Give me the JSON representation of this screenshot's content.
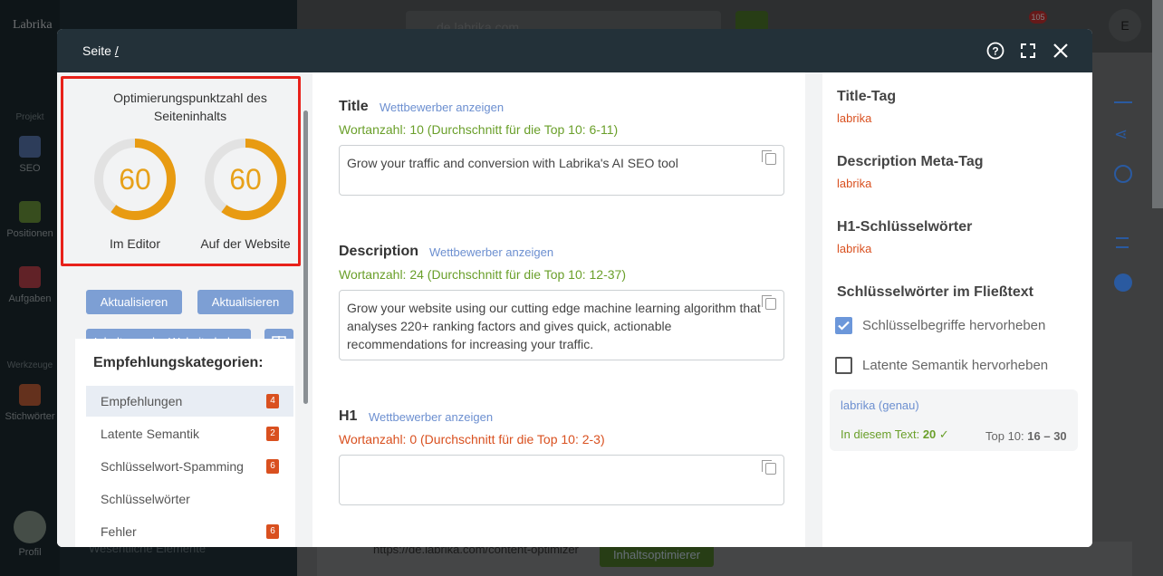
{
  "app": {
    "brand": "Labrika",
    "url_bar": "de.labrika.com",
    "notif_count": "105",
    "avatar_letter": "E"
  },
  "sidebar": {
    "sections": [
      {
        "label": "Projekt"
      },
      {
        "label": "Werkzeuge"
      }
    ],
    "items": [
      {
        "label": "SEO"
      },
      {
        "label": "Positionen"
      },
      {
        "label": "Aufgaben"
      },
      {
        "label": "Stichwörter"
      },
      {
        "label": "Profil"
      }
    ]
  },
  "background": {
    "nav_item": "Wesentliche Elemente",
    "page_url": "https://de.labrika.com/content-optimizer",
    "action_btn": "Inhaltsoptimierer"
  },
  "modal": {
    "title_prefix": "Seite",
    "title_path": "/",
    "scores": {
      "heading": "Optimierungspunktzahl des Seiteninhalts",
      "editor": {
        "value": "60",
        "fraction": 0.6,
        "label": "Im Editor"
      },
      "website": {
        "value": "60",
        "fraction": 0.6,
        "label": "Auf der Website"
      },
      "update_label": "Aktualisieren"
    },
    "load_btn": "Inhalt von der Website laden",
    "categories": {
      "title": "Empfehlungskategorien:",
      "items": [
        {
          "label": "Empfehlungen",
          "count": "4"
        },
        {
          "label": "Latente Semantik",
          "count": "2"
        },
        {
          "label": "Schlüsselwort-Spamming",
          "count": "6"
        },
        {
          "label": "Schlüsselwörter",
          "count": ""
        },
        {
          "label": "Fehler",
          "count": "6"
        }
      ]
    },
    "fields": {
      "competitors_link": "Wettbewerber anzeigen",
      "title": {
        "label": "Title",
        "wordcount": "Wortanzahl: 10 (Durchschnitt für die Top 10: 6-11)",
        "value": "Grow your traffic and conversion with Labrika's AI SEO tool"
      },
      "description": {
        "label": "Description",
        "wordcount": "Wortanzahl: 24 (Durchschnitt für die Top 10: 12-37)",
        "value": "Grow your website using our cutting edge machine learning algorithm that analyses 220+ ranking factors and gives quick, actionable recommendations for increasing your traffic."
      },
      "h1": {
        "label": "H1",
        "wordcount": "Wortanzahl: 0 (Durchschnitt für die Top 10: 2-3)",
        "value": ""
      }
    },
    "right": {
      "title_tag": {
        "label": "Title-Tag",
        "value": "labrika"
      },
      "description_tag": {
        "label": "Description Meta-Tag",
        "value": "labrika"
      },
      "h1_keywords": {
        "label": "H1-Schlüsselwörter",
        "value": "labrika"
      },
      "body_keywords": {
        "label": "Schlüsselwörter im Fließtext",
        "highlight_keys": {
          "label": "Schlüsselbegriffe hervorheben",
          "checked": true
        },
        "highlight_latent": {
          "label": "Latente Semantik hervorheben",
          "checked": false
        },
        "keyword": {
          "name": "labrika (genau)",
          "in_text_label": "In diesem Text:",
          "in_text_value": "20",
          "top10_label": "Top 10:",
          "top10_value": "16 – 30"
        }
      }
    }
  }
}
